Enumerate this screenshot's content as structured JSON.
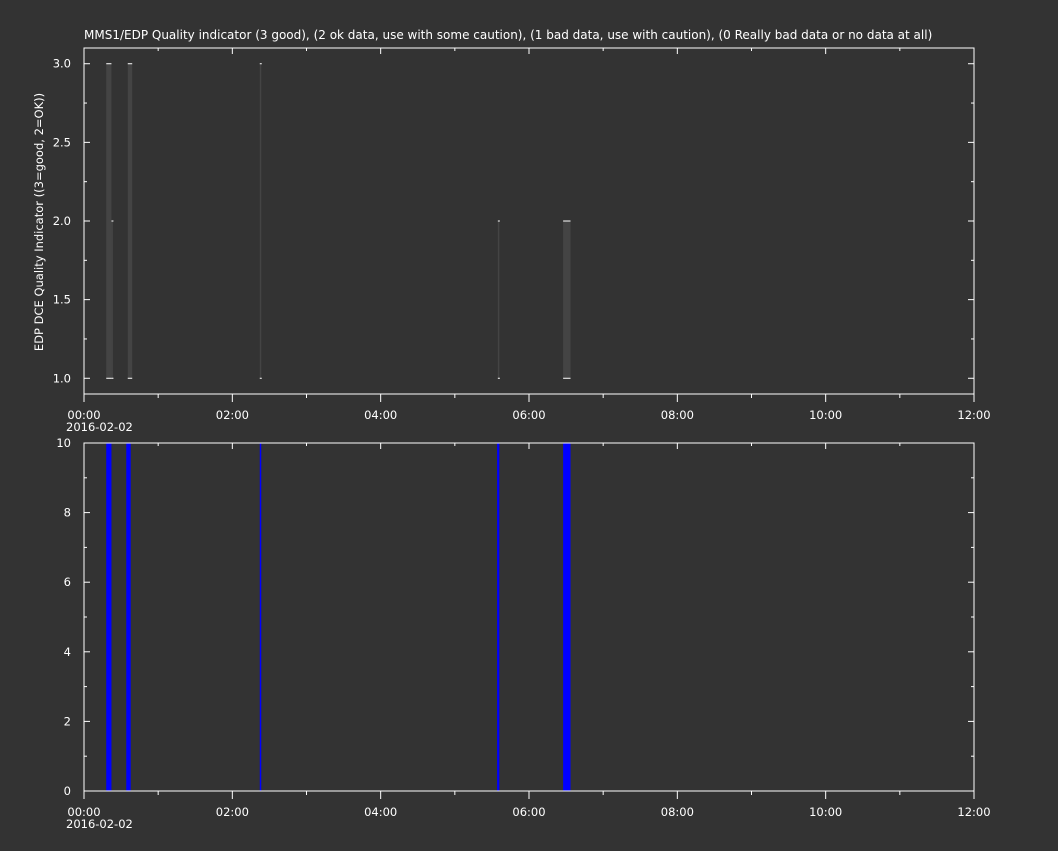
{
  "chart_data": [
    {
      "type": "bar",
      "title": "MMS1/EDP  Quality indicator (3 good), (2 ok data, use with some caution), (1 bad data, use with caution), (0 Really bad data or no data at all)",
      "ylabel": "EDP DCE Quality Indicator ((3=good, 2=OK))",
      "xlabel": "",
      "ylim": [
        0.9,
        3.1
      ],
      "yticks": [
        "1.0",
        "1.5",
        "2.0",
        "2.5",
        "3.0"
      ],
      "yticks_values": [
        1.0,
        1.5,
        2.0,
        2.5,
        3.0
      ],
      "xlim_hours": [
        0,
        12
      ],
      "xticks": [
        "00:00",
        "02:00",
        "04:00",
        "06:00",
        "08:00",
        "10:00",
        "12:00"
      ],
      "xticks_values_hours": [
        0,
        2,
        4,
        6,
        8,
        10,
        12
      ],
      "date_label": "2016-02-02",
      "grid": false,
      "series": [
        {
          "segments": [
            {
              "x0": 0.3,
              "x1": 0.37,
              "ymin": 1.0,
              "ymax": 3.0
            },
            {
              "x0": 0.37,
              "x1": 0.39,
              "ymin": 1.0,
              "ymax": 2.0
            },
            {
              "x0": 0.59,
              "x1": 0.65,
              "ymin": 1.0,
              "ymax": 3.0
            },
            {
              "x0": 2.37,
              "x1": 2.39,
              "ymin": 1.0,
              "ymax": 3.0
            },
            {
              "x0": 5.58,
              "x1": 5.6,
              "ymin": 1.0,
              "ymax": 2.0
            },
            {
              "x0": 6.46,
              "x1": 6.56,
              "ymin": 1.0,
              "ymax": 2.0
            }
          ]
        }
      ],
      "bar_color": "#444444",
      "tick_color": "#ffffff"
    },
    {
      "type": "bar",
      "title": "",
      "ylabel": "",
      "xlabel": "",
      "ylim": [
        0,
        10
      ],
      "yticks": [
        "0",
        "2",
        "4",
        "6",
        "8",
        "10"
      ],
      "yticks_values": [
        0,
        2,
        4,
        6,
        8,
        10
      ],
      "xlim_hours": [
        0,
        12
      ],
      "xticks": [
        "00:00",
        "02:00",
        "04:00",
        "06:00",
        "08:00",
        "10:00",
        "12:00"
      ],
      "xticks_values_hours": [
        0,
        2,
        4,
        6,
        8,
        10,
        12
      ],
      "date_label": "2016-02-02",
      "grid": false,
      "series": [
        {
          "segments": [
            {
              "x0": 0.3,
              "x1": 0.37,
              "ymin": 0,
              "ymax": 10
            },
            {
              "x0": 0.57,
              "x1": 0.63,
              "ymin": 0,
              "ymax": 10
            },
            {
              "x0": 2.37,
              "x1": 2.39,
              "ymin": 0,
              "ymax": 10
            },
            {
              "x0": 5.57,
              "x1": 5.6,
              "ymin": 0,
              "ymax": 10
            },
            {
              "x0": 6.46,
              "x1": 6.56,
              "ymin": 0,
              "ymax": 10
            }
          ]
        }
      ],
      "bar_color": "#0000ff"
    }
  ]
}
